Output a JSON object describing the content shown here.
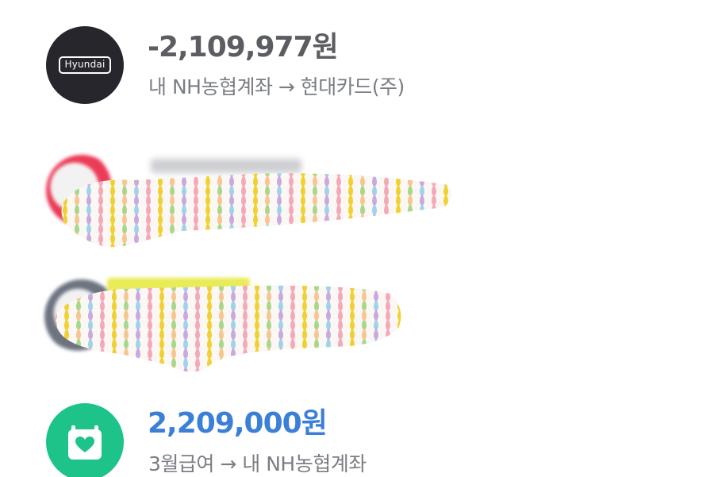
{
  "transactions": [
    {
      "avatar_logo_text": "Hyundai",
      "amount": "-2,109,977원",
      "description": "내 NH농협계좌 → 현대카드(주)",
      "icon": "hyundai-card-logo",
      "amount_color": "#5b5d63"
    },
    {
      "redacted": true,
      "icon": "redacted-avatar-red"
    },
    {
      "redacted": true,
      "icon": "redacted-avatar-gray"
    },
    {
      "amount": "2,209,000원",
      "description": "3월급여 → 내 NH농협계좌",
      "icon": "calendar-heart-icon",
      "amount_color": "#3b7fd8",
      "avatar_color": "#1ec38a"
    }
  ]
}
